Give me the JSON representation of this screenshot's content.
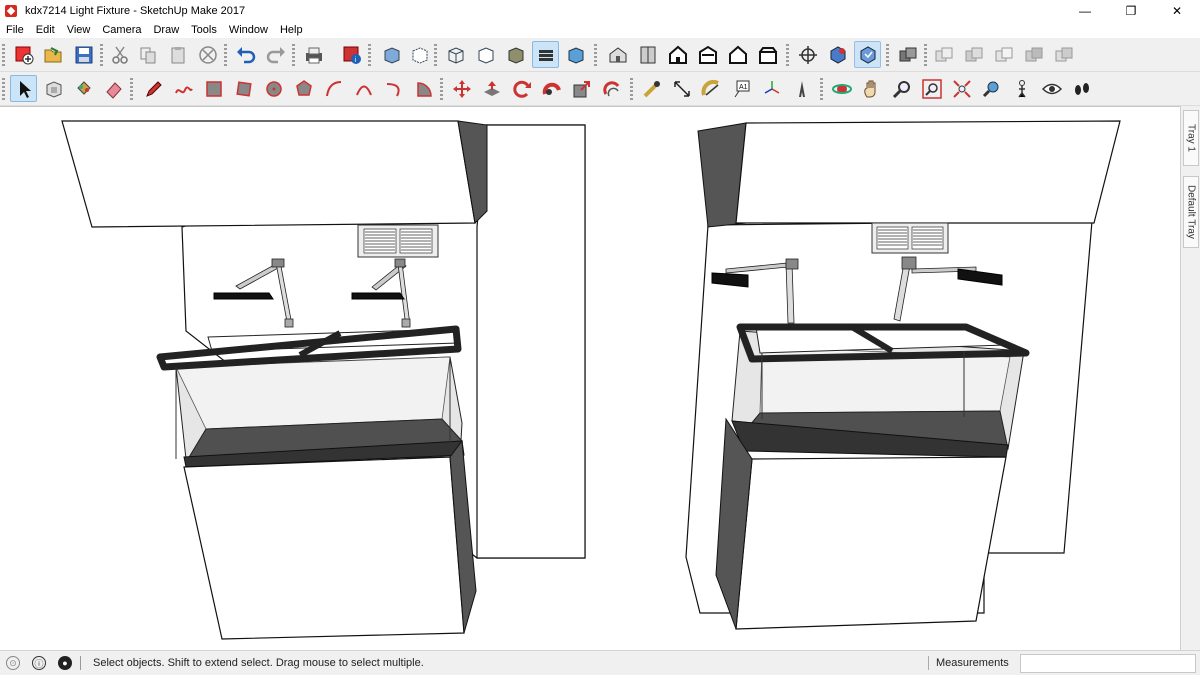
{
  "window": {
    "title": "kdx7214 Light Fixture - SketchUp Make 2017",
    "minimize": "—",
    "restore": "❐",
    "close": "✕"
  },
  "menu": [
    "File",
    "Edit",
    "View",
    "Camera",
    "Draw",
    "Tools",
    "Window",
    "Help"
  ],
  "toolbar1_icons": [
    "get-started-icon",
    "open-icon",
    "save-icon",
    "cut-icon",
    "copy-icon",
    "paste-icon",
    "erase-icon",
    "undo-icon",
    "redo-icon",
    "print-icon",
    "model-info-icon",
    "xray-icon",
    "back-edges-icon",
    "wireframe-icon",
    "hidden-line-icon",
    "shaded-icon",
    "shaded-textures-icon",
    "monochrome-icon",
    "iso-view-icon",
    "top-view-icon",
    "front-view-icon",
    "right-view-icon",
    "back-view-icon",
    "left-view-icon",
    "walkthrough-icon",
    "warehouse-icon",
    "extension-icon",
    "components-icon",
    "layer-1-icon",
    "layer-2-icon",
    "layer-3-icon",
    "layer-4-icon",
    "layer-5-icon"
  ],
  "toolbar2_icons": [
    "select-icon",
    "make-component-icon",
    "paint-bucket-icon",
    "eraser-icon",
    "pencil-icon",
    "freehand-icon",
    "rectangle-icon",
    "rotated-rectangle-icon",
    "circle-icon",
    "polygon-icon",
    "arc-icon",
    "two-point-arc-icon",
    "three-point-arc-icon",
    "pie-icon",
    "move-icon",
    "push-pull-icon",
    "rotate-icon",
    "follow-me-icon",
    "scale-icon",
    "offset-icon",
    "tape-measure-icon",
    "dimension-icon",
    "protractor-icon",
    "text-icon",
    "axes-icon",
    "3d-text-icon",
    "orbit-icon",
    "pan-icon",
    "zoom-icon",
    "zoom-window-icon",
    "zoom-extents-icon",
    "previous-view-icon",
    "position-camera-icon",
    "look-around-icon",
    "walk-icon"
  ],
  "tray": {
    "tab1": "Tray 1",
    "tab2": "Default Tray"
  },
  "status": {
    "message": "Select objects. Shift to extend select. Drag mouse to select multiple.",
    "measurements_label": "Measurements",
    "measurements_value": ""
  },
  "colors": {
    "accent_red": "#d52b1e",
    "toolbar_bg": "#f0f0f0",
    "selected_tool": "#cce4f7"
  }
}
